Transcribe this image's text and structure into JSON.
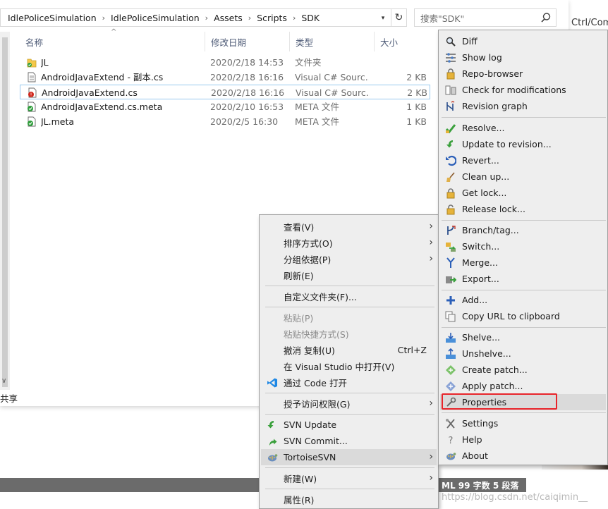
{
  "explorer": {
    "breadcrumb": [
      "IdlePoliceSimulation",
      "IdlePoliceSimulation",
      "Assets",
      "Scripts",
      "SDK"
    ],
    "search_placeholder": "搜索\"SDK\"",
    "tail_label": "Ctrl/Com",
    "columns": {
      "name": "名称",
      "date": "修改日期",
      "type": "类型",
      "size": "大小"
    },
    "share_label": "共享",
    "files": [
      {
        "name": "JL",
        "date": "2020/2/18 14:53",
        "type": "文件夹",
        "size": "",
        "icon": "folder-icon"
      },
      {
        "name": "AndroidJavaExtend - 副本.cs",
        "date": "2020/2/18 16:16",
        "type": "Visual C# Sourc...",
        "size": "2 KB",
        "icon": "document-icon"
      },
      {
        "name": "AndroidJavaExtend.cs",
        "date": "2020/2/18 16:16",
        "type": "Visual C# Sourc...",
        "size": "2 KB",
        "icon": "svn-modified-file-icon"
      },
      {
        "name": "AndroidJavaExtend.cs.meta",
        "date": "2020/2/10 16:53",
        "type": "META 文件",
        "size": "1 KB",
        "icon": "svn-normal-file-icon"
      },
      {
        "name": "JL.meta",
        "date": "2020/2/5 16:30",
        "type": "META 文件",
        "size": "1 KB",
        "icon": "svn-normal-file-icon"
      }
    ]
  },
  "status": {
    "text": "ML  99 字数  5 段落",
    "watermark": "https://blog.csdn.net/caiqimin__"
  },
  "context_menu": {
    "items": [
      {
        "label": "查看(V)",
        "submenu": true
      },
      {
        "label": "排序方式(O)",
        "submenu": true
      },
      {
        "label": "分组依据(P)",
        "submenu": true
      },
      {
        "label": "刷新(E)"
      },
      {
        "label": "自定义文件夹(F)..."
      },
      {
        "label": "粘贴(P)",
        "disabled": true
      },
      {
        "label": "粘贴快捷方式(S)",
        "disabled": true
      },
      {
        "label": "撤消 复制(U)",
        "shortcut": "Ctrl+Z"
      },
      {
        "label": "在 Visual Studio 中打开(V)"
      },
      {
        "label": "通过 Code 打开",
        "icon": "vscode-icon"
      },
      {
        "label": "授予访问权限(G)",
        "submenu": true
      },
      {
        "label": "SVN Update",
        "icon": "svn-update-icon"
      },
      {
        "label": "SVN Commit...",
        "icon": "svn-commit-icon"
      },
      {
        "label": "TortoiseSVN",
        "icon": "tortoisesvn-icon",
        "submenu": true
      },
      {
        "label": "新建(W)",
        "submenu": true
      },
      {
        "label": "属性(R)"
      }
    ]
  },
  "svn_menu": {
    "items": [
      {
        "label": "Diff",
        "icon": "diff-icon"
      },
      {
        "label": "Show log",
        "icon": "log-icon"
      },
      {
        "label": "Repo-browser",
        "icon": "repo-browser-icon"
      },
      {
        "label": "Check for modifications",
        "icon": "check-modifications-icon"
      },
      {
        "label": "Revision graph",
        "icon": "revision-graph-icon"
      },
      {
        "label": "Resolve...",
        "icon": "resolve-icon"
      },
      {
        "label": "Update to revision...",
        "icon": "update-revision-icon"
      },
      {
        "label": "Revert...",
        "icon": "revert-icon"
      },
      {
        "label": "Clean up...",
        "icon": "cleanup-icon"
      },
      {
        "label": "Get lock...",
        "icon": "lock-icon"
      },
      {
        "label": "Release lock...",
        "icon": "unlock-icon"
      },
      {
        "label": "Branch/tag...",
        "icon": "branch-icon"
      },
      {
        "label": "Switch...",
        "icon": "switch-icon"
      },
      {
        "label": "Merge...",
        "icon": "merge-icon"
      },
      {
        "label": "Export...",
        "icon": "export-icon"
      },
      {
        "label": "Add...",
        "icon": "add-icon"
      },
      {
        "label": "Copy URL to clipboard",
        "icon": "copy-url-icon"
      },
      {
        "label": "Shelve...",
        "icon": "shelve-icon"
      },
      {
        "label": "Unshelve...",
        "icon": "unshelve-icon"
      },
      {
        "label": "Create patch...",
        "icon": "create-patch-icon"
      },
      {
        "label": "Apply patch...",
        "icon": "apply-patch-icon"
      },
      {
        "label": "Properties",
        "icon": "properties-icon"
      },
      {
        "label": "Settings",
        "icon": "settings-icon"
      },
      {
        "label": "Help",
        "icon": "help-icon"
      },
      {
        "label": "About",
        "icon": "about-icon"
      }
    ]
  },
  "colors": {
    "highlight": "#e8242a",
    "hover": "#dadada",
    "menu_bg": "#eeeeee"
  }
}
